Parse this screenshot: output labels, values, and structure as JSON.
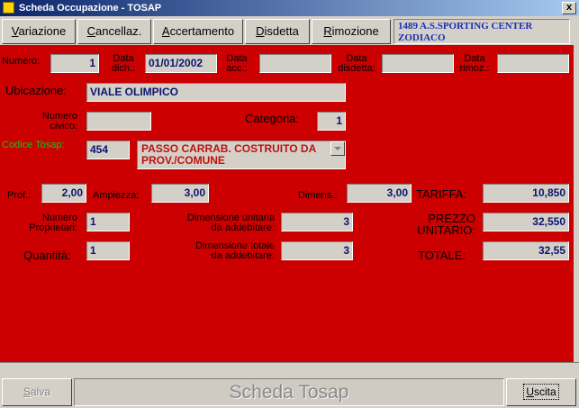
{
  "window": {
    "title": "Scheda Occupazione - TOSAP",
    "close_label": "x"
  },
  "menu": {
    "items": [
      {
        "pre": "",
        "u": "V",
        "post": "ariazione"
      },
      {
        "pre": "",
        "u": "C",
        "post": "ancellaz."
      },
      {
        "pre": "",
        "u": "A",
        "post": "ccertamento"
      },
      {
        "pre": "",
        "u": "D",
        "post": "isdetta"
      },
      {
        "pre": "",
        "u": "R",
        "post": "imozione"
      }
    ],
    "title_line1": "1489 A.S.SPORTING CENTER",
    "title_line2": "ZODIACO"
  },
  "form": {
    "numero_label": "Numero:",
    "numero_value": "1",
    "data_dich_label1": "Data",
    "data_dich_label2": "dich.:",
    "data_dich_value": "01/01/2002",
    "data_acc_label1": "Data",
    "data_acc_label2": "acc.:",
    "data_acc_value": "",
    "data_disdetta_label1": "Data",
    "data_disdetta_label2": "disdetta:",
    "data_disdetta_value": "",
    "data_rimoz_label1": "Data",
    "data_rimoz_label2": "rimoz.:",
    "data_rimoz_value": "",
    "ubicazione_label": "Ubicazione:",
    "ubicazione_value": "VIALE OLIMPICO",
    "numero_civico_label1": "Numero",
    "numero_civico_label2": "civico:",
    "numero_civico_value": "",
    "categoria_label": "Categoria:",
    "categoria_value": "1",
    "codice_tosap_label": "Codice Tosap:",
    "codice_tosap_value": "454",
    "codice_desc": "PASSO CARRAB. COSTRUITO DA PROV./COMUNE",
    "prof_label": "Prof.:",
    "prof_value": "2,00",
    "ampiezza_label": "Ampiezza:",
    "ampiezza_value": "3,00",
    "dimens_label": "Dimens.:",
    "dimens_value": "3,00",
    "tariffa_label": "TARIFFA:",
    "tariffa_value": "10,850",
    "numero_proprietari_label1": "Numero",
    "numero_proprietari_label2": "Proprietari:",
    "numero_proprietari_value": "1",
    "dim_unitaria_label1": "Dimensione unitaria",
    "dim_unitaria_label2": "da addebitare:",
    "dim_unitaria_value": "3",
    "prezzo_unitario_label1": "PREZZO",
    "prezzo_unitario_label2": "UNITARIO:",
    "prezzo_unitario_value": "32,550",
    "quantita_label": "Quantità:",
    "quantita_value": "1",
    "dim_totale_label1": "Dimensione totale",
    "dim_totale_label2": "da addebitare:",
    "dim_totale_value": "3",
    "totale_label": "TOTALE:",
    "totale_value": "32,55"
  },
  "footer": {
    "salva_u": "S",
    "salva_post": "alva",
    "title": "Scheda Tosap",
    "uscita_u": "U",
    "uscita_post": "scita"
  },
  "colors": {
    "form_bg": "#cc0000",
    "field_text": "#0a1570",
    "green_label": "#19c01d",
    "title_bar": "#0a246a"
  }
}
